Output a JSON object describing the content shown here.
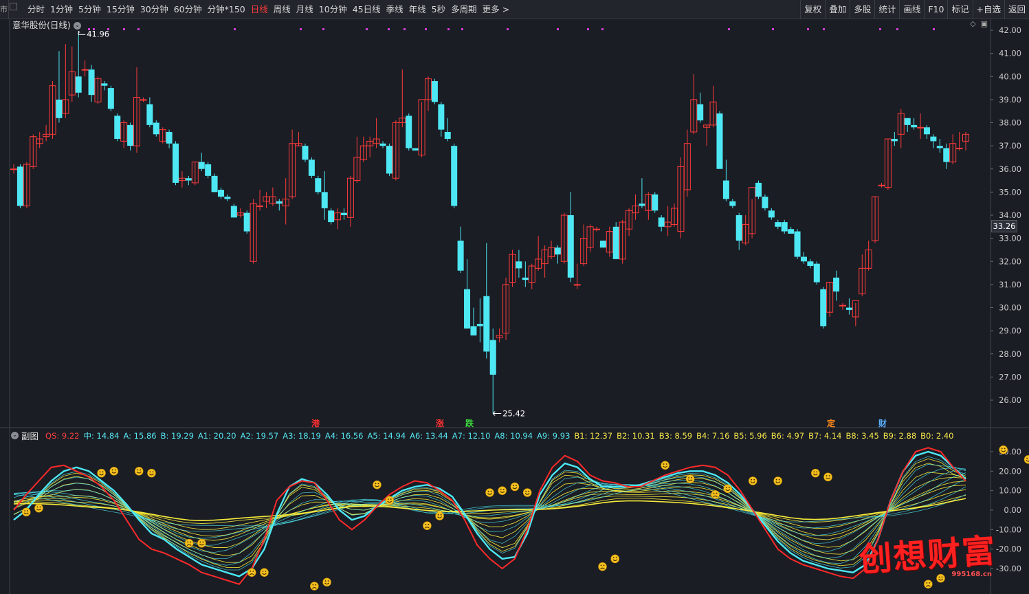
{
  "toolbar": {
    "left_edge": "市",
    "items": [
      "分时",
      "1分钟",
      "5分钟",
      "15分钟",
      "30分钟",
      "60分钟",
      "分钟*150",
      "日线",
      "周线",
      "月线",
      "10分钟",
      "45日线",
      "季线",
      "年线",
      "5秒",
      "多周期",
      "更多 >"
    ],
    "active": "日线",
    "right_items": [
      "复权",
      "叠加",
      "多股",
      "统计",
      "画线",
      "F10",
      "标记",
      "+自选",
      "返回"
    ]
  },
  "main_chart": {
    "title": "意华股份(日线)",
    "high_label": "41.96",
    "low_label": "25.42",
    "current_price": "33.26",
    "y_ticks": [
      "42.00",
      "41.00",
      "40.00",
      "39.00",
      "38.00",
      "37.00",
      "36.00",
      "35.00",
      "34.00",
      "33.00",
      "32.00",
      "31.00",
      "30.00",
      "29.00",
      "28.00",
      "27.00",
      "26.00"
    ],
    "events": [
      {
        "text": "港",
        "color": "#ff3030"
      },
      {
        "text": "涨",
        "color": "#ff3030"
      },
      {
        "text": "跌",
        "color": "#3cdc3c"
      },
      {
        "text": "定",
        "color": "#ff8a1a"
      },
      {
        "text": "财",
        "color": "#5ab0ff"
      }
    ]
  },
  "sub_chart": {
    "title": "副图",
    "indicators": [
      {
        "text": "QS: 9.22",
        "cls": "qs"
      },
      {
        "text": "中: 14.84",
        "cls": "cyan"
      },
      {
        "text": "A: 15.86",
        "cls": "cyan"
      },
      {
        "text": "B: 19.29",
        "cls": "cyan"
      },
      {
        "text": "A1: 20.20",
        "cls": "cyan"
      },
      {
        "text": "A2: 19.57",
        "cls": "cyan"
      },
      {
        "text": "A3: 18.19",
        "cls": "cyan"
      },
      {
        "text": "A4: 16.56",
        "cls": "cyan"
      },
      {
        "text": "A5: 14.94",
        "cls": "cyan"
      },
      {
        "text": "A6: 13.44",
        "cls": "cyan"
      },
      {
        "text": "A7: 12.10",
        "cls": "cyan"
      },
      {
        "text": "A8: 10.94",
        "cls": "cyan"
      },
      {
        "text": "A9: 9.93",
        "cls": "cyan"
      },
      {
        "text": "B1: 12.37",
        "cls": "yellow"
      },
      {
        "text": "B2: 10.31",
        "cls": "yellow"
      },
      {
        "text": "B3: 8.59",
        "cls": "yellow"
      },
      {
        "text": "B4: 7.16",
        "cls": "yellow"
      },
      {
        "text": "B5: 5.96",
        "cls": "yellow"
      },
      {
        "text": "B6: 4.97",
        "cls": "yellow"
      },
      {
        "text": "B7: 4.14",
        "cls": "yellow"
      },
      {
        "text": "B8: 3.45",
        "cls": "yellow"
      },
      {
        "text": "B9: 2.88",
        "cls": "yellow"
      },
      {
        "text": "B0: 2.40",
        "cls": "yellow"
      }
    ],
    "y_ticks": [
      "30.00",
      "20.00",
      "10.00",
      "0.00",
      "-10.00",
      "-20.00",
      "-30.00"
    ]
  },
  "watermark": {
    "text": "创想财富",
    "url": "995168.cn"
  },
  "colors": {
    "up": "#ff3b3b",
    "down": "#4de8f4",
    "bg": "#1a1d24",
    "qs": "#ff2a2a",
    "fast": "#4de8f4",
    "slow": "#f6ea3a"
  },
  "chart_data": {
    "type": "candlestick",
    "ylim": [
      25.4,
      42.2
    ],
    "candles": [
      [
        36.0,
        36.2,
        35.8,
        36.0
      ],
      [
        36.1,
        36.2,
        34.3,
        34.4
      ],
      [
        34.4,
        36.3,
        34.3,
        36.2
      ],
      [
        36.1,
        37.5,
        36.0,
        37.4
      ],
      [
        37.1,
        37.6,
        36.9,
        37.3
      ],
      [
        37.4,
        37.9,
        37.2,
        37.5
      ],
      [
        37.5,
        39.8,
        37.3,
        39.6
      ],
      [
        39.0,
        41.1,
        38.0,
        38.2
      ],
      [
        38.4,
        41.4,
        38.2,
        39.0
      ],
      [
        39.2,
        41.3,
        38.9,
        40.2
      ],
      [
        40.0,
        41.96,
        39.1,
        39.3
      ],
      [
        40.3,
        40.7,
        40.0,
        40.3
      ],
      [
        40.3,
        40.5,
        38.9,
        39.2
      ],
      [
        38.9,
        40.0,
        38.8,
        39.9
      ],
      [
        39.7,
        39.8,
        39.4,
        39.6
      ],
      [
        39.5,
        39.6,
        38.5,
        38.6
      ],
      [
        38.3,
        38.4,
        37.2,
        37.3
      ],
      [
        37.2,
        38.1,
        36.9,
        38.0
      ],
      [
        37.9,
        38.0,
        36.8,
        37.0
      ],
      [
        37.0,
        40.4,
        36.7,
        39.1
      ],
      [
        39.0,
        39.1,
        38.9,
        39.0
      ],
      [
        38.8,
        39.1,
        37.8,
        37.9
      ],
      [
        38.0,
        38.1,
        37.4,
        37.5
      ],
      [
        37.2,
        37.8,
        37.1,
        37.7
      ],
      [
        37.6,
        37.7,
        36.9,
        37.1
      ],
      [
        37.1,
        37.2,
        35.3,
        35.4
      ],
      [
        35.5,
        35.9,
        35.2,
        35.6
      ],
      [
        35.6,
        35.7,
        35.3,
        35.5
      ],
      [
        35.4,
        36.3,
        35.3,
        36.3
      ],
      [
        36.3,
        36.7,
        35.9,
        36.0
      ],
      [
        36.2,
        36.3,
        35.6,
        35.7
      ],
      [
        35.7,
        35.8,
        35.0,
        35.0
      ],
      [
        35.1,
        35.2,
        34.7,
        34.8
      ],
      [
        34.8,
        34.9,
        34.6,
        34.7
      ],
      [
        34.4,
        34.5,
        33.9,
        33.9
      ],
      [
        34.0,
        34.3,
        33.9,
        34.1
      ],
      [
        34.1,
        34.2,
        33.2,
        33.3
      ],
      [
        32.0,
        34.7,
        31.9,
        34.5
      ],
      [
        34.4,
        35.1,
        34.2,
        34.4
      ],
      [
        34.6,
        35.0,
        34.3,
        34.8
      ],
      [
        34.5,
        35.2,
        34.4,
        34.8
      ],
      [
        34.6,
        34.7,
        34.2,
        34.5
      ],
      [
        34.4,
        35.6,
        33.6,
        34.7
      ],
      [
        34.8,
        37.7,
        34.7,
        37.1
      ],
      [
        37.0,
        37.6,
        37.0,
        37.1
      ],
      [
        37.0,
        37.1,
        36.3,
        36.4
      ],
      [
        36.4,
        36.5,
        35.6,
        35.7
      ],
      [
        35.6,
        35.7,
        34.9,
        35.0
      ],
      [
        35.0,
        35.9,
        33.8,
        34.3
      ],
      [
        34.2,
        34.3,
        33.6,
        33.7
      ],
      [
        33.8,
        34.3,
        33.4,
        34.1
      ],
      [
        34.1,
        34.3,
        33.8,
        34.0
      ],
      [
        33.9,
        35.7,
        33.5,
        35.6
      ],
      [
        35.5,
        37.4,
        35.4,
        36.5
      ],
      [
        36.4,
        37.4,
        36.3,
        37.0
      ],
      [
        37.0,
        37.4,
        36.5,
        37.2
      ],
      [
        37.1,
        38.2,
        36.9,
        37.3
      ],
      [
        37.1,
        37.2,
        36.9,
        37.0
      ],
      [
        37.0,
        37.1,
        35.7,
        35.8
      ],
      [
        35.6,
        38.1,
        35.5,
        38.0
      ],
      [
        38.0,
        40.3,
        37.8,
        38.2
      ],
      [
        38.3,
        38.4,
        36.8,
        36.9
      ],
      [
        36.9,
        36.9,
        36.8,
        36.8
      ],
      [
        36.6,
        38.9,
        36.5,
        39.0
      ],
      [
        39.0,
        40.0,
        38.5,
        39.9
      ],
      [
        39.8,
        39.9,
        38.8,
        38.9
      ],
      [
        38.8,
        38.9,
        37.4,
        37.7
      ],
      [
        37.6,
        38.2,
        37.2,
        37.3
      ],
      [
        37.0,
        37.1,
        34.3,
        34.4
      ],
      [
        32.9,
        33.5,
        31.5,
        31.6
      ],
      [
        30.8,
        32.1,
        29.1,
        29.1
      ],
      [
        29.2,
        30.0,
        28.8,
        28.8
      ],
      [
        29.3,
        30.4,
        28.5,
        29.2
      ],
      [
        30.5,
        32.8,
        27.8,
        28.1
      ],
      [
        28.6,
        29.1,
        25.42,
        27.1
      ],
      [
        28.7,
        29.1,
        28.5,
        28.8
      ],
      [
        28.9,
        31.3,
        28.6,
        31.0
      ],
      [
        31.1,
        32.5,
        30.9,
        32.3
      ],
      [
        32.0,
        32.5,
        31.3,
        31.7
      ],
      [
        31.3,
        32.0,
        30.9,
        31.2
      ],
      [
        31.1,
        31.9,
        30.8,
        31.8
      ],
      [
        31.7,
        33.1,
        31.6,
        32.1
      ],
      [
        31.9,
        32.7,
        31.3,
        32.5
      ],
      [
        32.2,
        32.9,
        32.1,
        32.6
      ],
      [
        32.6,
        32.7,
        31.9,
        32.3
      ],
      [
        32.0,
        34.1,
        31.9,
        34.0
      ],
      [
        34.0,
        35.0,
        31.1,
        31.3
      ],
      [
        31.0,
        31.9,
        30.8,
        31.0
      ],
      [
        31.9,
        33.6,
        31.8,
        33.0
      ],
      [
        32.6,
        33.6,
        32.4,
        33.5
      ],
      [
        33.4,
        33.5,
        33.3,
        33.4
      ],
      [
        32.9,
        32.9,
        32.6,
        32.6
      ],
      [
        32.4,
        33.5,
        32.2,
        33.3
      ],
      [
        33.5,
        33.7,
        32.1,
        32.1
      ],
      [
        32.1,
        33.8,
        31.9,
        33.7
      ],
      [
        33.4,
        34.3,
        33.1,
        34.2
      ],
      [
        34.1,
        34.9,
        33.8,
        34.4
      ],
      [
        34.5,
        35.6,
        34.3,
        34.4
      ],
      [
        34.2,
        35.0,
        33.8,
        34.9
      ],
      [
        34.9,
        35.0,
        34.1,
        34.2
      ],
      [
        33.9,
        34.0,
        33.3,
        33.5
      ],
      [
        33.5,
        34.4,
        33.1,
        33.7
      ],
      [
        33.6,
        34.5,
        33.5,
        34.3
      ],
      [
        33.3,
        36.5,
        33.0,
        36.1
      ],
      [
        35.1,
        37.7,
        34.8,
        37.1
      ],
      [
        37.6,
        40.1,
        37.5,
        39.0
      ],
      [
        38.8,
        39.3,
        38.0,
        38.1
      ],
      [
        37.8,
        37.9,
        37.0,
        37.9
      ],
      [
        37.9,
        39.6,
        37.8,
        38.9
      ],
      [
        38.4,
        38.5,
        36.2,
        36.0
      ],
      [
        35.5,
        36.4,
        34.6,
        34.7
      ],
      [
        34.6,
        34.7,
        34.3,
        34.4
      ],
      [
        34.0,
        34.1,
        32.5,
        32.9
      ],
      [
        32.8,
        34.0,
        32.7,
        33.6
      ],
      [
        33.2,
        34.7,
        33.0,
        35.2
      ],
      [
        35.4,
        35.5,
        34.7,
        34.8
      ],
      [
        34.8,
        34.9,
        34.2,
        34.3
      ],
      [
        34.2,
        34.3,
        33.8,
        33.9
      ],
      [
        33.7,
        33.8,
        33.4,
        33.5
      ],
      [
        33.7,
        33.8,
        33.2,
        33.3
      ],
      [
        33.4,
        33.5,
        33.2,
        33.2
      ],
      [
        33.3,
        33.4,
        32.1,
        32.2
      ],
      [
        32.2,
        32.4,
        31.9,
        32.0
      ],
      [
        32.0,
        32.1,
        31.7,
        31.8
      ],
      [
        31.9,
        32.0,
        31.0,
        31.1
      ],
      [
        30.8,
        30.9,
        29.1,
        29.2
      ],
      [
        29.8,
        31.1,
        29.6,
        31.1
      ],
      [
        31.3,
        31.6,
        30.3,
        30.7
      ],
      [
        30.1,
        30.2,
        29.9,
        30.1
      ],
      [
        30.0,
        30.4,
        29.7,
        29.9
      ],
      [
        29.6,
        30.2,
        29.2,
        30.3
      ],
      [
        30.6,
        32.3,
        30.5,
        31.7
      ],
      [
        31.7,
        32.9,
        31.6,
        32.5
      ],
      [
        32.9,
        34.8,
        32.8,
        34.8
      ],
      [
        35.3,
        35.4,
        35.2,
        35.3
      ],
      [
        35.2,
        37.3,
        35.1,
        37.3
      ],
      [
        37.3,
        37.6,
        37.0,
        37.2
      ],
      [
        37.5,
        38.6,
        36.9,
        38.4
      ],
      [
        38.2,
        38.2,
        37.6,
        37.9
      ],
      [
        37.9,
        38.2,
        37.7,
        37.8
      ],
      [
        37.8,
        38.4,
        37.3,
        37.8
      ],
      [
        37.8,
        37.9,
        37.3,
        37.5
      ],
      [
        37.4,
        37.5,
        36.9,
        37.2
      ],
      [
        37.0,
        37.3,
        36.7,
        36.9
      ],
      [
        36.9,
        37.1,
        36.0,
        36.3
      ],
      [
        36.3,
        37.5,
        36.2,
        37.1
      ],
      [
        36.9,
        37.6,
        36.8,
        36.9
      ],
      [
        37.2,
        37.6,
        36.8,
        37.5
      ]
    ],
    "sub_ylim": [
      -35,
      36
    ],
    "sub_series": {
      "qs": [
        0,
        8,
        15,
        22,
        23,
        20,
        17,
        12,
        5,
        -5,
        -15,
        -20,
        -22,
        -25,
        -28,
        -32,
        -34,
        -36,
        -38,
        -30,
        -15,
        5,
        12,
        15,
        14,
        5,
        -5,
        -10,
        -5,
        2,
        8,
        12,
        15,
        14,
        10,
        5,
        -5,
        -18,
        -25,
        -30,
        -25,
        -10,
        10,
        22,
        28,
        25,
        18,
        15,
        14,
        12,
        12,
        15,
        18,
        20,
        22,
        23,
        22,
        18,
        10,
        0,
        -10,
        -20,
        -25,
        -28,
        -30,
        -32,
        -34,
        -35,
        -30,
        -15,
        5,
        20,
        30,
        32,
        30,
        22,
        15
      ],
      "fast": [
        -5,
        0,
        8,
        15,
        20,
        22,
        20,
        15,
        10,
        3,
        -5,
        -12,
        -15,
        -20,
        -24,
        -28,
        -30,
        -32,
        -34,
        -30,
        -20,
        -2,
        12,
        16,
        14,
        8,
        0,
        -5,
        -3,
        2,
        6,
        10,
        12,
        13,
        11,
        7,
        -2,
        -12,
        -20,
        -25,
        -24,
        -12,
        8,
        18,
        24,
        22,
        16,
        12,
        12,
        12,
        13,
        15,
        17,
        19,
        20,
        20,
        18,
        14,
        8,
        0,
        -8,
        -16,
        -22,
        -26,
        -28,
        -30,
        -31,
        -32,
        -28,
        -15,
        5,
        20,
        28,
        30,
        28,
        22,
        16
      ]
    },
    "markers": [
      {
        "i": 1,
        "type": "smile",
        "v": -1
      },
      {
        "i": 2,
        "type": "smile",
        "v": 1
      },
      {
        "i": 7,
        "type": "smile",
        "v": 19
      },
      {
        "i": 8,
        "type": "smile",
        "v": 20
      },
      {
        "i": 10,
        "type": "smile",
        "v": 20
      },
      {
        "i": 11,
        "type": "smile",
        "v": 19
      },
      {
        "i": 14,
        "type": "frown",
        "v": -17
      },
      {
        "i": 15,
        "type": "smile",
        "v": -17
      },
      {
        "i": 19,
        "type": "frown",
        "v": -32
      },
      {
        "i": 20,
        "type": "smile",
        "v": -32
      },
      {
        "i": 24,
        "type": "frown",
        "v": -39
      },
      {
        "i": 25,
        "type": "smile",
        "v": -37
      },
      {
        "i": 29,
        "type": "smile",
        "v": 13
      },
      {
        "i": 30,
        "type": "smile",
        "v": 5
      },
      {
        "i": 33,
        "type": "frown",
        "v": -8
      },
      {
        "i": 34,
        "type": "smile",
        "v": -3
      },
      {
        "i": 38,
        "type": "smile",
        "v": 9
      },
      {
        "i": 39,
        "type": "smile",
        "v": 10
      },
      {
        "i": 40,
        "type": "smile",
        "v": 12
      },
      {
        "i": 41,
        "type": "smile",
        "v": 9
      },
      {
        "i": 47,
        "type": "frown",
        "v": -29
      },
      {
        "i": 48,
        "type": "smile",
        "v": -25
      },
      {
        "i": 52,
        "type": "smile",
        "v": 23
      },
      {
        "i": 54,
        "type": "smile",
        "v": 16
      },
      {
        "i": 56,
        "type": "frown",
        "v": 8
      },
      {
        "i": 57,
        "type": "smile",
        "v": 11
      },
      {
        "i": 59,
        "type": "smile",
        "v": 15
      },
      {
        "i": 61,
        "type": "smile",
        "v": 15
      },
      {
        "i": 64,
        "type": "smile",
        "v": 19
      },
      {
        "i": 65,
        "type": "smile",
        "v": 17
      },
      {
        "i": 73,
        "type": "frown",
        "v": -38
      },
      {
        "i": 74,
        "type": "smile",
        "v": -35
      },
      {
        "i": 79,
        "type": "smile",
        "v": 31
      },
      {
        "i": 81,
        "type": "smile",
        "v": 26
      }
    ]
  }
}
